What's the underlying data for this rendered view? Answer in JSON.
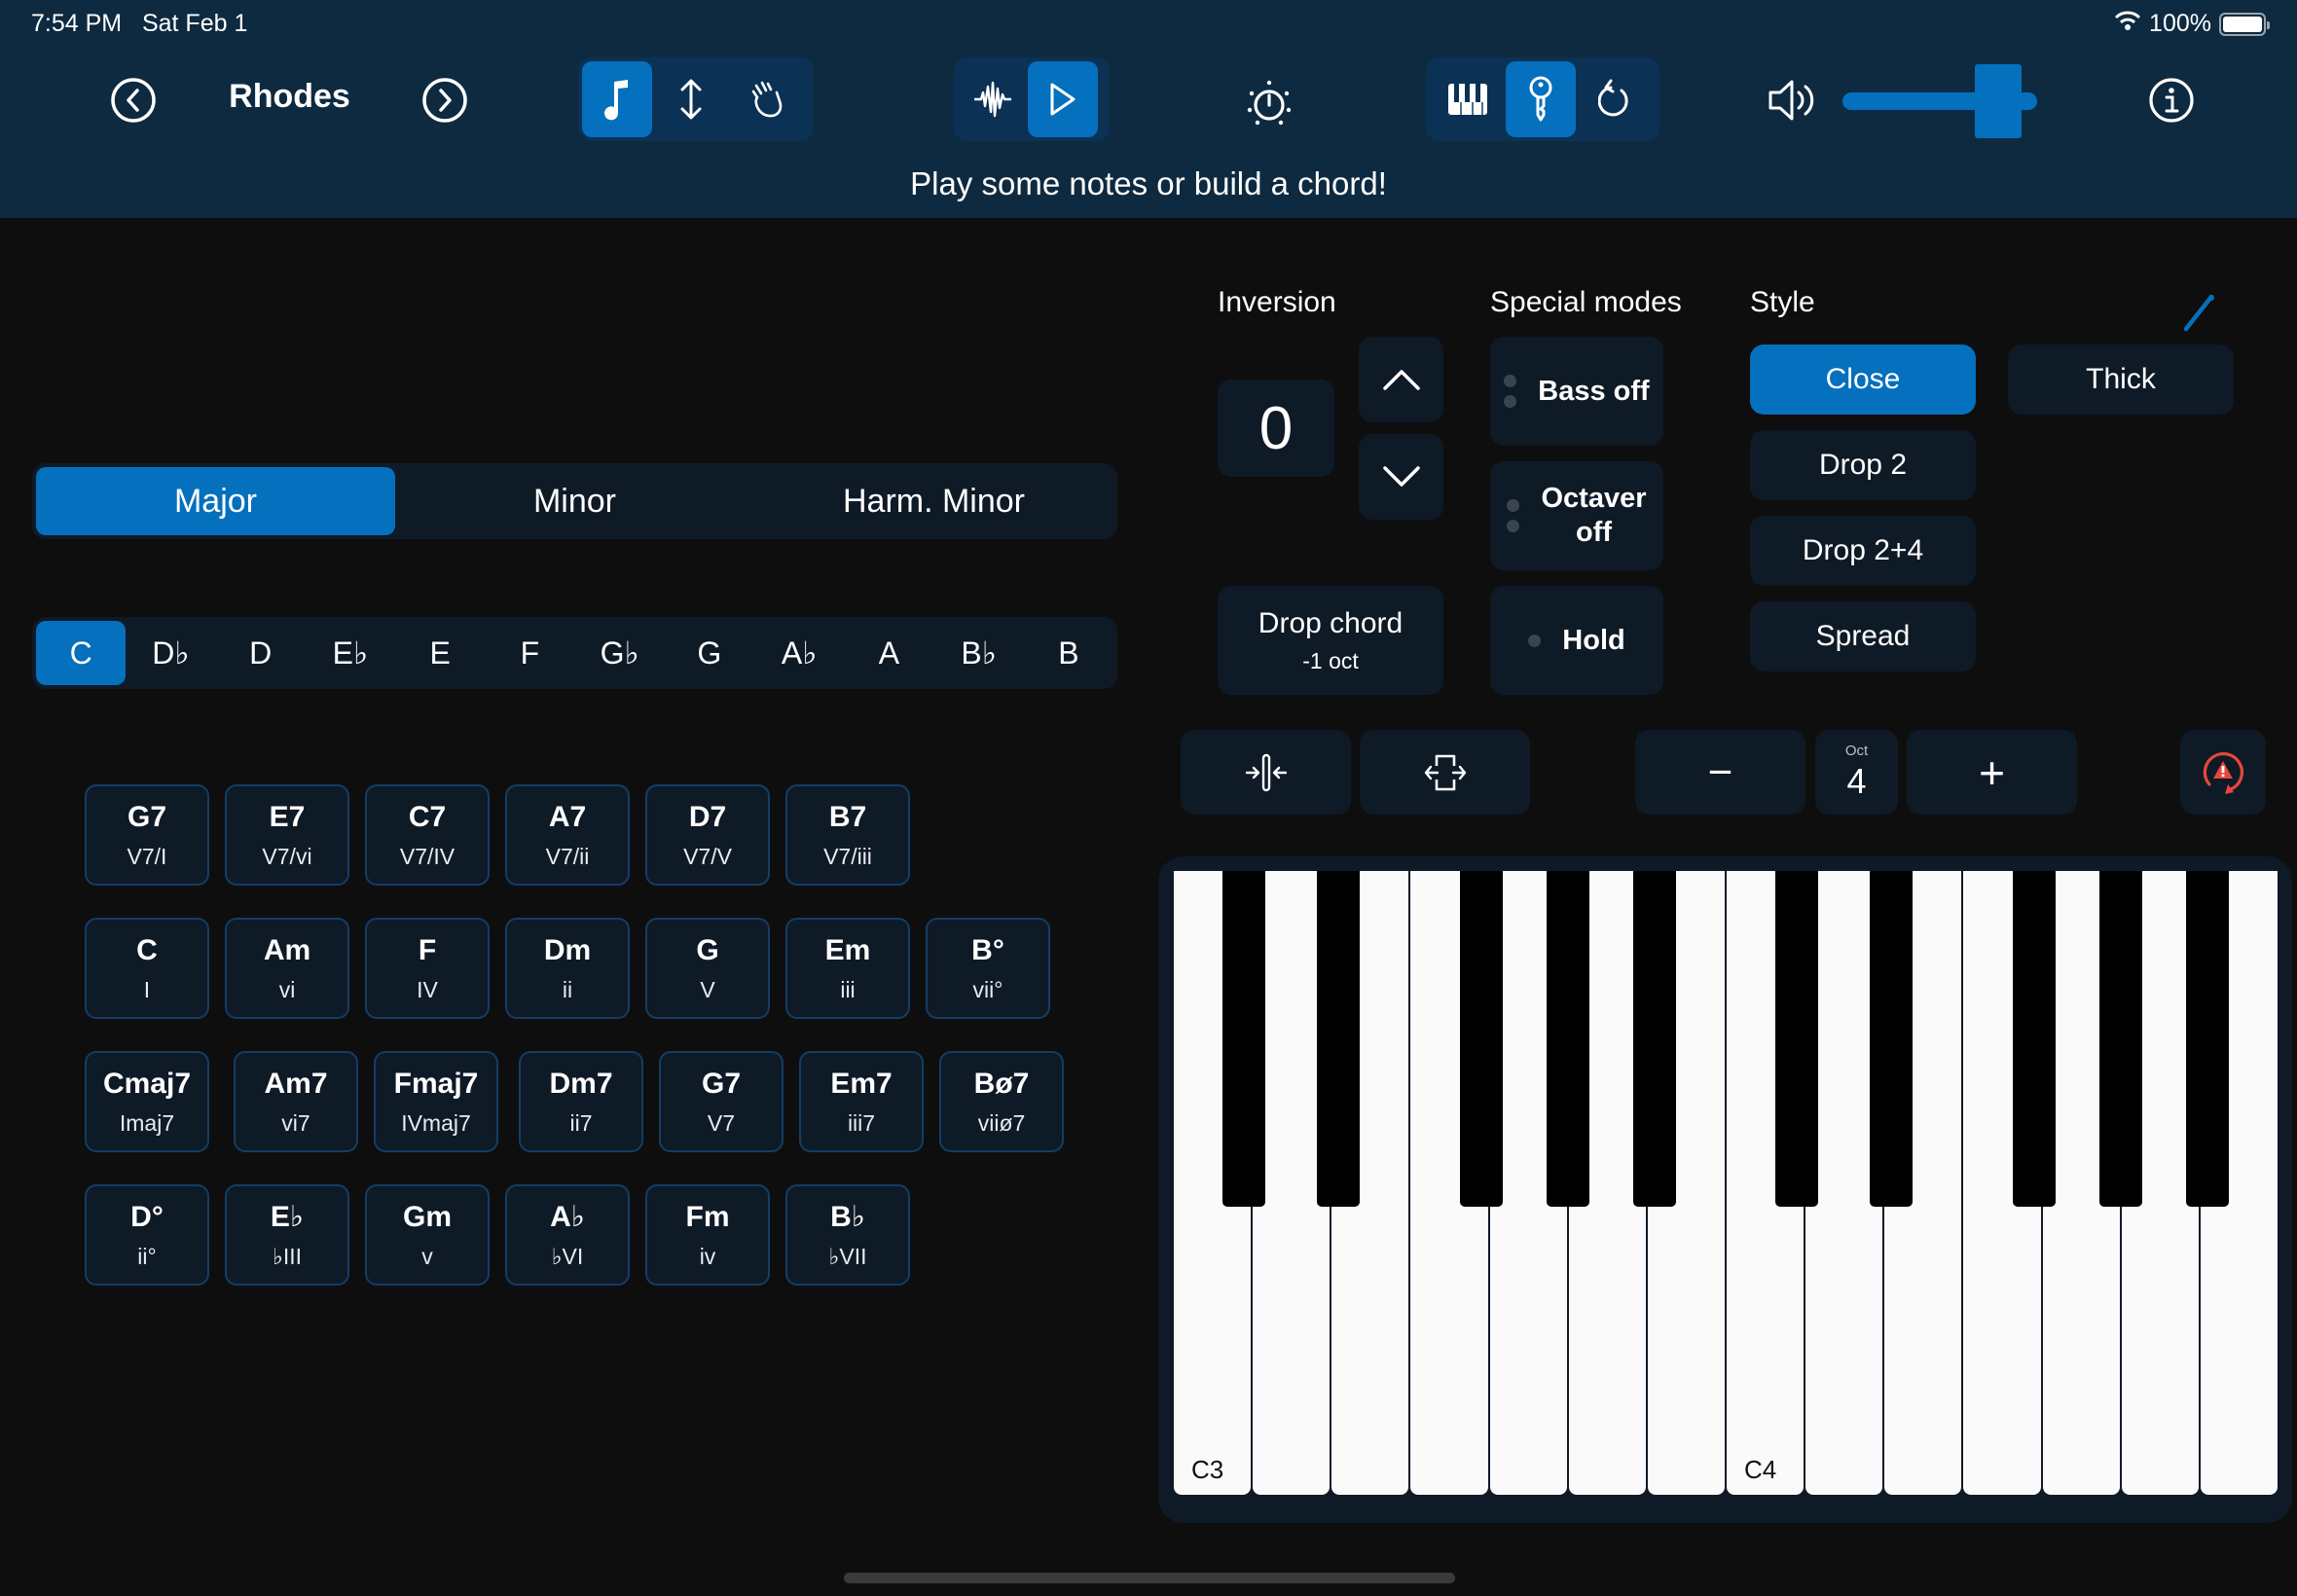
{
  "status_bar": {
    "time": "7:54 PM",
    "date": "Sat Feb 1",
    "battery": "100%"
  },
  "header": {
    "instrument_title": "Rhodes",
    "prev_icon": "chevron-left-circle-icon",
    "next_icon": "chevron-right-circle-icon",
    "mode_group": [
      {
        "icon": "music-note-icon",
        "active": true
      },
      {
        "icon": "vertical-arrows-icon",
        "active": false
      },
      {
        "icon": "hand-wave-icon",
        "active": false
      }
    ],
    "playback_group": [
      {
        "icon": "waveform-icon",
        "active": false
      },
      {
        "icon": "play-icon",
        "active": true
      }
    ],
    "metronome_icon": "metronome-icon",
    "view_group": [
      {
        "icon": "piano-keys-icon",
        "active": false
      },
      {
        "icon": "key-icon",
        "active": true
      },
      {
        "icon": "undo-icon",
        "active": false
      }
    ],
    "volume": {
      "icon": "speaker-icon",
      "value": 0.8
    },
    "info_icon": "info-icon",
    "subtitle": "Play some notes or build a chord!"
  },
  "scale_selector": {
    "options": [
      "Major",
      "Minor",
      "Harm. Minor"
    ],
    "selected": "Major"
  },
  "key_selector": {
    "options": [
      "C",
      "D♭",
      "D",
      "E♭",
      "E",
      "F",
      "G♭",
      "G",
      "A♭",
      "A",
      "B♭",
      "B"
    ],
    "selected": "C"
  },
  "chord_rows": [
    [
      {
        "name": "G7",
        "roman": "V7/I"
      },
      {
        "name": "E7",
        "roman": "V7/vi"
      },
      {
        "name": "C7",
        "roman": "V7/IV"
      },
      {
        "name": "A7",
        "roman": "V7/ii"
      },
      {
        "name": "D7",
        "roman": "V7/V"
      },
      {
        "name": "B7",
        "roman": "V7/iii"
      }
    ],
    [
      {
        "name": "C",
        "roman": "I"
      },
      {
        "name": "Am",
        "roman": "vi"
      },
      {
        "name": "F",
        "roman": "IV"
      },
      {
        "name": "Dm",
        "roman": "ii"
      },
      {
        "name": "G",
        "roman": "V"
      },
      {
        "name": "Em",
        "roman": "iii"
      },
      {
        "name": "B°",
        "roman": "vii°"
      }
    ],
    [
      {
        "name": "Cmaj7",
        "roman": "Imaj7"
      },
      {
        "name": "Am7",
        "roman": "vi7"
      },
      {
        "name": "Fmaj7",
        "roman": "IVmaj7"
      },
      {
        "name": "Dm7",
        "roman": "ii7"
      },
      {
        "name": "G7",
        "roman": "V7"
      },
      {
        "name": "Em7",
        "roman": "iii7"
      },
      {
        "name": "Bø7",
        "roman": "viiø7"
      }
    ],
    [
      {
        "name": "D°",
        "roman": "ii°"
      },
      {
        "name": "E♭",
        "roman": "♭III"
      },
      {
        "name": "Gm",
        "roman": "v"
      },
      {
        "name": "A♭",
        "roman": "♭VI"
      },
      {
        "name": "Fm",
        "roman": "iv"
      },
      {
        "name": "B♭",
        "roman": "♭VII"
      }
    ]
  ],
  "inversion": {
    "label": "Inversion",
    "value": "0",
    "up_icon": "chevron-up-icon",
    "down_icon": "chevron-down-icon",
    "drop_chord_label": "Drop chord",
    "drop_chord_sub": "-1 oct"
  },
  "special_modes": {
    "label": "Special modes",
    "items": [
      {
        "label": "Bass off"
      },
      {
        "label": "Octaver off"
      },
      {
        "label": "Hold"
      }
    ]
  },
  "style": {
    "label": "Style",
    "edit_icon": "pencil-icon",
    "options": [
      "Close",
      "Drop 2",
      "Drop 2+4",
      "Spread",
      "Thick"
    ],
    "selected": "Close"
  },
  "keyboard_toolbar": {
    "compress_icon": "compress-icon",
    "expand_icon": "expand-icon",
    "minus_label": "−",
    "octave_label": "Oct",
    "octave_value": "4",
    "plus_label": "+",
    "panic_icon": "warning-reset-icon"
  },
  "keyboard": {
    "labels": {
      "0": "C3",
      "7": "C4"
    },
    "white_key_count": 14
  },
  "colors": {
    "accent": "#0570bd",
    "header_bg": "#0e2a40",
    "panel_bg": "#0f1a27",
    "warning": "#e8463c"
  }
}
